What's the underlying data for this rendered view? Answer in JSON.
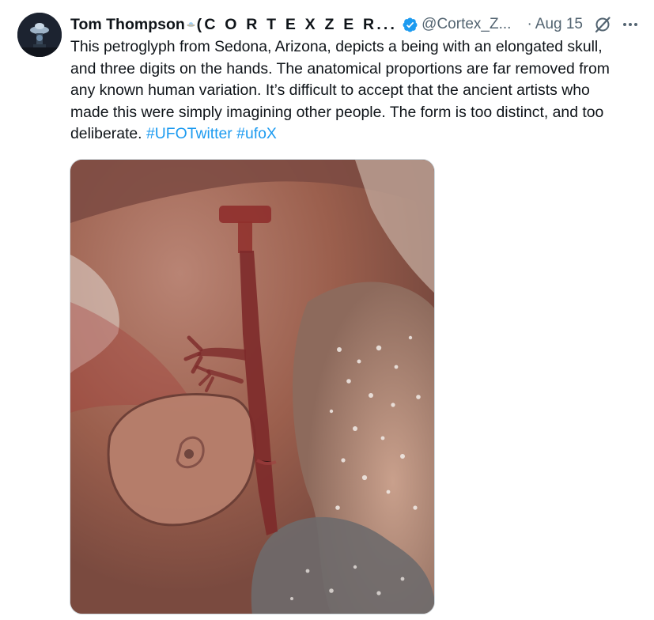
{
  "tweet": {
    "display_name": "Tom Thompson",
    "name_rest": "(C O R T E X  Z E R...",
    "handle": "@Cortex_Z...",
    "separator": "·",
    "date": "Aug 15",
    "text_main": "This petroglyph from Sedona, Arizona, depicts a being with an elongated skull, and three digits on the hands. The anatomical proportions are far removed from any known human variation. It’s difficult to accept that the ancient artists who made this were simply imagining other people. The form is too distinct, and too deliberate.",
    "hashtags": [
      "#UFOTwitter",
      "#ufoX"
    ],
    "icons": {
      "avatar": "ufo-avatar",
      "emoji": "flying-saucer-emoji",
      "verified": "verified-badge-icon",
      "grok": "grok-icon",
      "more": "more-options-icon"
    },
    "colors": {
      "text": "#0f1419",
      "secondary": "#536471",
      "link": "#1d9bf0",
      "verified": "#1d9bf0"
    }
  }
}
